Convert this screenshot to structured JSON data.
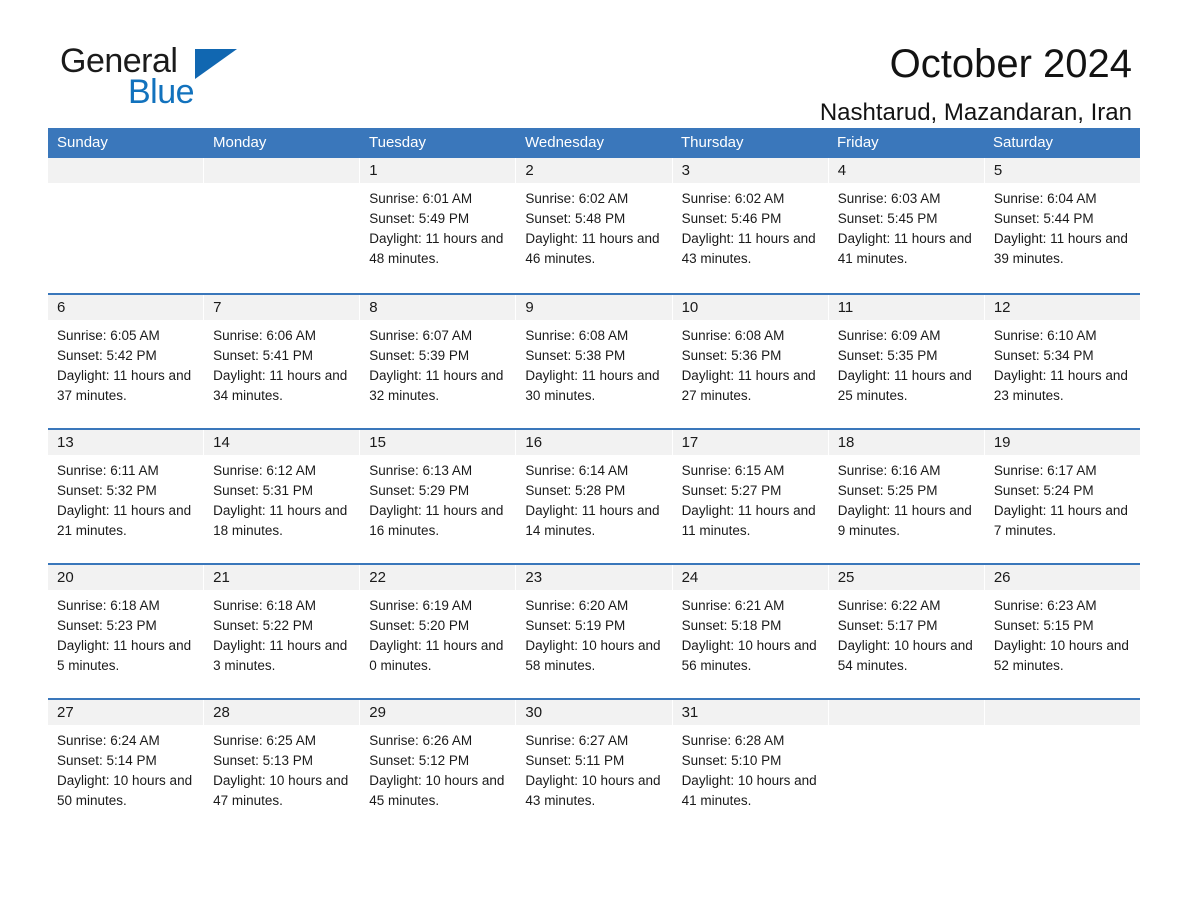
{
  "brand": {
    "name_part1": "General",
    "name_part2": "Blue",
    "logo_icon": "triangle-icon"
  },
  "header": {
    "month_title": "October 2024",
    "location_title": "Nashtarud, Mazandaran, Iran"
  },
  "colors": {
    "header_blue": "#3a77bb",
    "brand_blue": "#1272bd",
    "logo_blue": "#1167b1",
    "day_band_gray": "#f2f2f2"
  },
  "calendar": {
    "weekday_headers": [
      "Sunday",
      "Monday",
      "Tuesday",
      "Wednesday",
      "Thursday",
      "Friday",
      "Saturday"
    ],
    "weeks": [
      [
        {
          "day": "",
          "sunrise": "",
          "sunset": "",
          "daylight": "",
          "empty": true
        },
        {
          "day": "",
          "sunrise": "",
          "sunset": "",
          "daylight": "",
          "empty": true
        },
        {
          "day": "1",
          "sunrise": "Sunrise: 6:01 AM",
          "sunset": "Sunset: 5:49 PM",
          "daylight": "Daylight: 11 hours and 48 minutes."
        },
        {
          "day": "2",
          "sunrise": "Sunrise: 6:02 AM",
          "sunset": "Sunset: 5:48 PM",
          "daylight": "Daylight: 11 hours and 46 minutes."
        },
        {
          "day": "3",
          "sunrise": "Sunrise: 6:02 AM",
          "sunset": "Sunset: 5:46 PM",
          "daylight": "Daylight: 11 hours and 43 minutes."
        },
        {
          "day": "4",
          "sunrise": "Sunrise: 6:03 AM",
          "sunset": "Sunset: 5:45 PM",
          "daylight": "Daylight: 11 hours and 41 minutes."
        },
        {
          "day": "5",
          "sunrise": "Sunrise: 6:04 AM",
          "sunset": "Sunset: 5:44 PM",
          "daylight": "Daylight: 11 hours and 39 minutes."
        }
      ],
      [
        {
          "day": "6",
          "sunrise": "Sunrise: 6:05 AM",
          "sunset": "Sunset: 5:42 PM",
          "daylight": "Daylight: 11 hours and 37 minutes."
        },
        {
          "day": "7",
          "sunrise": "Sunrise: 6:06 AM",
          "sunset": "Sunset: 5:41 PM",
          "daylight": "Daylight: 11 hours and 34 minutes."
        },
        {
          "day": "8",
          "sunrise": "Sunrise: 6:07 AM",
          "sunset": "Sunset: 5:39 PM",
          "daylight": "Daylight: 11 hours and 32 minutes."
        },
        {
          "day": "9",
          "sunrise": "Sunrise: 6:08 AM",
          "sunset": "Sunset: 5:38 PM",
          "daylight": "Daylight: 11 hours and 30 minutes."
        },
        {
          "day": "10",
          "sunrise": "Sunrise: 6:08 AM",
          "sunset": "Sunset: 5:36 PM",
          "daylight": "Daylight: 11 hours and 27 minutes."
        },
        {
          "day": "11",
          "sunrise": "Sunrise: 6:09 AM",
          "sunset": "Sunset: 5:35 PM",
          "daylight": "Daylight: 11 hours and 25 minutes."
        },
        {
          "day": "12",
          "sunrise": "Sunrise: 6:10 AM",
          "sunset": "Sunset: 5:34 PM",
          "daylight": "Daylight: 11 hours and 23 minutes."
        }
      ],
      [
        {
          "day": "13",
          "sunrise": "Sunrise: 6:11 AM",
          "sunset": "Sunset: 5:32 PM",
          "daylight": "Daylight: 11 hours and 21 minutes."
        },
        {
          "day": "14",
          "sunrise": "Sunrise: 6:12 AM",
          "sunset": "Sunset: 5:31 PM",
          "daylight": "Daylight: 11 hours and 18 minutes."
        },
        {
          "day": "15",
          "sunrise": "Sunrise: 6:13 AM",
          "sunset": "Sunset: 5:29 PM",
          "daylight": "Daylight: 11 hours and 16 minutes."
        },
        {
          "day": "16",
          "sunrise": "Sunrise: 6:14 AM",
          "sunset": "Sunset: 5:28 PM",
          "daylight": "Daylight: 11 hours and 14 minutes."
        },
        {
          "day": "17",
          "sunrise": "Sunrise: 6:15 AM",
          "sunset": "Sunset: 5:27 PM",
          "daylight": "Daylight: 11 hours and 11 minutes."
        },
        {
          "day": "18",
          "sunrise": "Sunrise: 6:16 AM",
          "sunset": "Sunset: 5:25 PM",
          "daylight": "Daylight: 11 hours and 9 minutes."
        },
        {
          "day": "19",
          "sunrise": "Sunrise: 6:17 AM",
          "sunset": "Sunset: 5:24 PM",
          "daylight": "Daylight: 11 hours and 7 minutes."
        }
      ],
      [
        {
          "day": "20",
          "sunrise": "Sunrise: 6:18 AM",
          "sunset": "Sunset: 5:23 PM",
          "daylight": "Daylight: 11 hours and 5 minutes."
        },
        {
          "day": "21",
          "sunrise": "Sunrise: 6:18 AM",
          "sunset": "Sunset: 5:22 PM",
          "daylight": "Daylight: 11 hours and 3 minutes."
        },
        {
          "day": "22",
          "sunrise": "Sunrise: 6:19 AM",
          "sunset": "Sunset: 5:20 PM",
          "daylight": "Daylight: 11 hours and 0 minutes."
        },
        {
          "day": "23",
          "sunrise": "Sunrise: 6:20 AM",
          "sunset": "Sunset: 5:19 PM",
          "daylight": "Daylight: 10 hours and 58 minutes."
        },
        {
          "day": "24",
          "sunrise": "Sunrise: 6:21 AM",
          "sunset": "Sunset: 5:18 PM",
          "daylight": "Daylight: 10 hours and 56 minutes."
        },
        {
          "day": "25",
          "sunrise": "Sunrise: 6:22 AM",
          "sunset": "Sunset: 5:17 PM",
          "daylight": "Daylight: 10 hours and 54 minutes."
        },
        {
          "day": "26",
          "sunrise": "Sunrise: 6:23 AM",
          "sunset": "Sunset: 5:15 PM",
          "daylight": "Daylight: 10 hours and 52 minutes."
        }
      ],
      [
        {
          "day": "27",
          "sunrise": "Sunrise: 6:24 AM",
          "sunset": "Sunset: 5:14 PM",
          "daylight": "Daylight: 10 hours and 50 minutes."
        },
        {
          "day": "28",
          "sunrise": "Sunrise: 6:25 AM",
          "sunset": "Sunset: 5:13 PM",
          "daylight": "Daylight: 10 hours and 47 minutes."
        },
        {
          "day": "29",
          "sunrise": "Sunrise: 6:26 AM",
          "sunset": "Sunset: 5:12 PM",
          "daylight": "Daylight: 10 hours and 45 minutes."
        },
        {
          "day": "30",
          "sunrise": "Sunrise: 6:27 AM",
          "sunset": "Sunset: 5:11 PM",
          "daylight": "Daylight: 10 hours and 43 minutes."
        },
        {
          "day": "31",
          "sunrise": "Sunrise: 6:28 AM",
          "sunset": "Sunset: 5:10 PM",
          "daylight": "Daylight: 10 hours and 41 minutes."
        },
        {
          "day": "",
          "sunrise": "",
          "sunset": "",
          "daylight": "",
          "empty": true
        },
        {
          "day": "",
          "sunrise": "",
          "sunset": "",
          "daylight": "",
          "empty": true
        }
      ]
    ]
  }
}
